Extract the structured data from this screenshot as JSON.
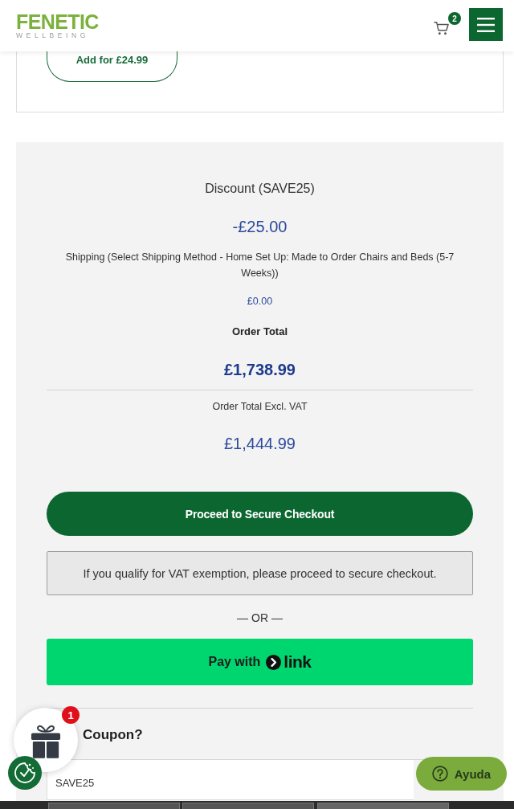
{
  "header": {
    "logo_wordmark": "FENETIC",
    "logo_tagline": "WELLBEING",
    "cart_count": "2"
  },
  "upsell": {
    "button": "Add for £24.99"
  },
  "summary": {
    "lines": [
      {
        "kind": "label",
        "text": "Discount (SAVE25)"
      },
      {
        "kind": "amount",
        "text": "-£25.00"
      },
      {
        "kind": "note",
        "text": "Shipping (Select Shipping Method - Home Set Up: Made to Order Chairs and Beds (5-7 Weeks))"
      },
      {
        "kind": "note-amount",
        "text": "£0.00"
      },
      {
        "kind": "total-label",
        "text": "Order Total"
      },
      {
        "kind": "total",
        "text": "£1,738.99"
      },
      {
        "kind": "note",
        "text": "Order Total Excl. VAT"
      },
      {
        "kind": "amount",
        "text": "£1,444.99"
      }
    ]
  },
  "checkout_button": "Proceed to Secure Checkout",
  "vat_notice": "If you qualify for VAT exemption, please proceed to secure checkout.",
  "separator": "— OR —",
  "link_button": {
    "prefix": "Pay with",
    "brand": "link"
  },
  "coupon": {
    "heading": "Coupon?",
    "value": "SAVE25"
  },
  "gift_widget": {
    "badge": "1"
  },
  "help_button": "Ayuda"
}
